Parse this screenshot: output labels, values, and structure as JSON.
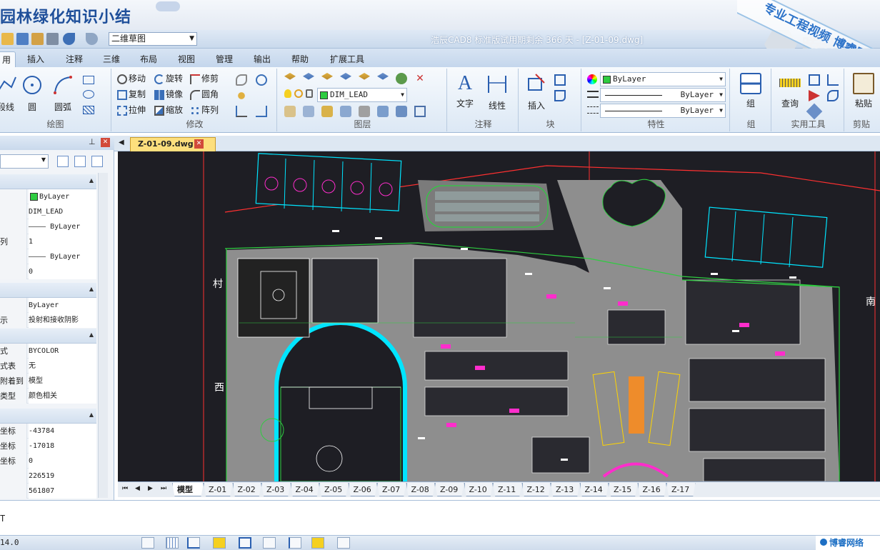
{
  "banner": {
    "title": "园林绿化知识小结",
    "watermark": "专业工程视频 博睿网络",
    "tencent_text": "腾讯"
  },
  "quick_access": {
    "workspace": "二维草图",
    "app_title": "浩辰CAD8 标准版试用期剩余 366 天 - [Z-01-09.dwg]"
  },
  "tabs": [
    "用",
    "插入",
    "注释",
    "三维",
    "布局",
    "视图",
    "管理",
    "输出",
    "帮助",
    "扩展工具"
  ],
  "ribbon": {
    "draw": {
      "label": "绘图",
      "polyline": "段线",
      "circle": "圆",
      "arc": "圆弧"
    },
    "modify": {
      "label": "修改",
      "move": "移动",
      "rotate": "旋转",
      "trim": "修剪",
      "copy": "复制",
      "mirror": "镜像",
      "fillet": "圆角",
      "stretch": "拉伸",
      "scale": "缩放",
      "array": "阵列"
    },
    "layers": {
      "label": "图层",
      "current": "DIM_LEAD"
    },
    "annotation": {
      "label": "注释",
      "text": "文字",
      "linear": "线性"
    },
    "block": {
      "label": "块",
      "insert": "插入"
    },
    "properties": {
      "label": "特性",
      "color": "ByLayer",
      "linetype": "ByLayer",
      "lineweight": "ByLayer"
    },
    "group": {
      "label": "组",
      "group": "组"
    },
    "utilities": {
      "label": "实用工具",
      "measure": "查询"
    },
    "clipboard": {
      "label": "剪贴",
      "paste": "粘贴"
    }
  },
  "properties_panel": {
    "general": [
      {
        "k": "",
        "v": "ByLayer"
      },
      {
        "k": "",
        "v": "DIM_LEAD"
      },
      {
        "k": "",
        "v": "———— ByLayer"
      },
      {
        "k": "列",
        "v": "1"
      },
      {
        "k": "",
        "v": "———— ByLayer"
      },
      {
        "k": "",
        "v": "0"
      }
    ],
    "material": [
      {
        "k": "",
        "v": "ByLayer"
      },
      {
        "k": "示",
        "v": "投射和接收阴影"
      }
    ],
    "plot": [
      {
        "k": "式",
        "v": "BYCOLOR"
      },
      {
        "k": "式表",
        "v": "无"
      },
      {
        "k": "附着到",
        "v": "模型"
      },
      {
        "k": "类型",
        "v": "颜色相关"
      }
    ],
    "view": [
      {
        "k": "坐标",
        "v": "-43784"
      },
      {
        "k": "坐标",
        "v": "-17018"
      },
      {
        "k": "坐标",
        "v": "0"
      },
      {
        "k": "",
        "v": "226519"
      },
      {
        "k": "",
        "v": "561807"
      }
    ]
  },
  "document": {
    "tab": "Z-01-09.dwg"
  },
  "layout_tabs": [
    "模型",
    "Z-01",
    "Z-02",
    "Z-03",
    "Z-04",
    "Z-05",
    "Z-06",
    "Z-07",
    "Z-08",
    "Z-09",
    "Z-10",
    "Z-11",
    "Z-12",
    "Z-13",
    "Z-14",
    "Z-15",
    "Z-16",
    "Z-17"
  ],
  "drawing_labels": {
    "west": "西",
    "north_left": "村",
    "south": "南"
  },
  "command_line": {
    "text": "T"
  },
  "status": {
    "coords": "14.0",
    "brand": "博睿网络"
  },
  "colors": {
    "canvas": "#1e1e24",
    "paving": "#8e8e8e",
    "cyan": "#00e5ff",
    "green": "#2ecc40",
    "magenta": "#ff2dcc",
    "red": "#ff3030",
    "yellow": "#ffd400"
  }
}
